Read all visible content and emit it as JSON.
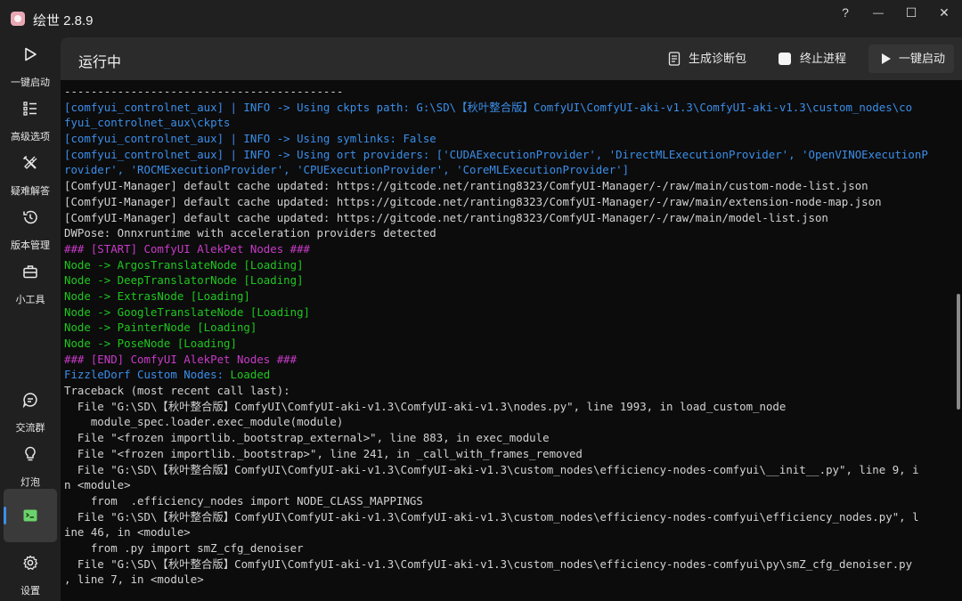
{
  "app": {
    "title": "绘世 2.8.9"
  },
  "window_controls": {
    "help": "?",
    "minimize": "—",
    "maximize": "☐",
    "close": "✕"
  },
  "sidebar": {
    "items": [
      {
        "label": "一键启动",
        "icon": "play-icon"
      },
      {
        "label": "高级选项",
        "icon": "list-options-icon"
      },
      {
        "label": "疑难解答",
        "icon": "tools-icon"
      },
      {
        "label": "版本管理",
        "icon": "history-icon"
      },
      {
        "label": "小工具",
        "icon": "toolbox-icon"
      },
      {
        "label": "交流群",
        "icon": "chat-icon"
      },
      {
        "label": "灯泡",
        "icon": "lightbulb-icon"
      },
      {
        "label": "",
        "icon": "console-icon"
      },
      {
        "label": "设置",
        "icon": "gear-icon"
      }
    ]
  },
  "header": {
    "title": "运行中",
    "diag_label": "生成诊断包",
    "terminate_label": "终止进程",
    "launch_label": "一键启动"
  },
  "colors": {
    "accent": "#3b8ee8",
    "console_bg": "#0c0c0c",
    "blue": "#3b8eea",
    "green": "#1fc71f",
    "magenta": "#c73bc7"
  },
  "console": {
    "lines": [
      {
        "t": "------------------------------------------",
        "c": "white"
      },
      {
        "t": "[comfyui_controlnet_aux] | INFO -> Using ckpts path: G:\\SD\\【秋叶整合版】ComfyUI\\ComfyUI-aki-v1.3\\ComfyUI-aki-v1.3\\custom_nodes\\co",
        "c": "blue"
      },
      {
        "t": "fyui_controlnet_aux\\ckpts",
        "c": "blue"
      },
      {
        "t": "[comfyui_controlnet_aux] | INFO -> Using symlinks: False",
        "c": "blue"
      },
      {
        "t": "[comfyui_controlnet_aux] | INFO -> Using ort providers: ['CUDAExecutionProvider', 'DirectMLExecutionProvider', 'OpenVINOExecutionP",
        "c": "blue"
      },
      {
        "t": "rovider', 'ROCMExecutionProvider', 'CPUExecutionProvider', 'CoreMLExecutionProvider']",
        "c": "blue"
      },
      {
        "t": "[ComfyUI-Manager] default cache updated: https://gitcode.net/ranting8323/ComfyUI-Manager/-/raw/main/custom-node-list.json",
        "c": "white"
      },
      {
        "t": "[ComfyUI-Manager] default cache updated: https://gitcode.net/ranting8323/ComfyUI-Manager/-/raw/main/extension-node-map.json",
        "c": "white"
      },
      {
        "t": "[ComfyUI-Manager] default cache updated: https://gitcode.net/ranting8323/ComfyUI-Manager/-/raw/main/model-list.json",
        "c": "white"
      },
      {
        "t": "DWPose: Onnxruntime with acceleration providers detected",
        "c": "white"
      },
      {
        "t": "### [START] ComfyUI AlekPet Nodes ###",
        "c": "magenta"
      },
      {
        "t": "Node -> ArgosTranslateNode [Loading]",
        "c": "green"
      },
      {
        "t": "Node -> DeepTranslatorNode [Loading]",
        "c": "green"
      },
      {
        "t": "Node -> ExtrasNode [Loading]",
        "c": "green"
      },
      {
        "t": "Node -> GoogleTranslateNode [Loading]",
        "c": "green"
      },
      {
        "t": "Node -> PainterNode [Loading]",
        "c": "green"
      },
      {
        "t": "Node -> PoseNode [Loading]",
        "c": "green"
      },
      {
        "t": "### [END] ComfyUI AlekPet Nodes ###",
        "c": "magenta"
      },
      {
        "t": "FizzleDorf Custom Nodes: Loaded",
        "c": "blue",
        "tail": "Loaded",
        "tail_c": "green"
      },
      {
        "t": "Traceback (most recent call last):",
        "c": "white"
      },
      {
        "t": "  File \"G:\\SD\\【秋叶整合版】ComfyUI\\ComfyUI-aki-v1.3\\ComfyUI-aki-v1.3\\nodes.py\", line 1993, in load_custom_node",
        "c": "white"
      },
      {
        "t": "    module_spec.loader.exec_module(module)",
        "c": "white"
      },
      {
        "t": "  File \"<frozen importlib._bootstrap_external>\", line 883, in exec_module",
        "c": "white"
      },
      {
        "t": "  File \"<frozen importlib._bootstrap>\", line 241, in _call_with_frames_removed",
        "c": "white"
      },
      {
        "t": "  File \"G:\\SD\\【秋叶整合版】ComfyUI\\ComfyUI-aki-v1.3\\ComfyUI-aki-v1.3\\custom_nodes\\efficiency-nodes-comfyui\\__init__.py\", line 9, i",
        "c": "white"
      },
      {
        "t": "n <module>",
        "c": "white"
      },
      {
        "t": "    from  .efficiency_nodes import NODE_CLASS_MAPPINGS",
        "c": "white"
      },
      {
        "t": "  File \"G:\\SD\\【秋叶整合版】ComfyUI\\ComfyUI-aki-v1.3\\ComfyUI-aki-v1.3\\custom_nodes\\efficiency-nodes-comfyui\\efficiency_nodes.py\", l",
        "c": "white"
      },
      {
        "t": "ine 46, in <module>",
        "c": "white"
      },
      {
        "t": "    from .py import smZ_cfg_denoiser",
        "c": "white"
      },
      {
        "t": "  File \"G:\\SD\\【秋叶整合版】ComfyUI\\ComfyUI-aki-v1.3\\ComfyUI-aki-v1.3\\custom_nodes\\efficiency-nodes-comfyui\\py\\smZ_cfg_denoiser.py",
        "c": "white"
      },
      {
        "t": ", line 7, in <module>",
        "c": "white"
      }
    ]
  }
}
